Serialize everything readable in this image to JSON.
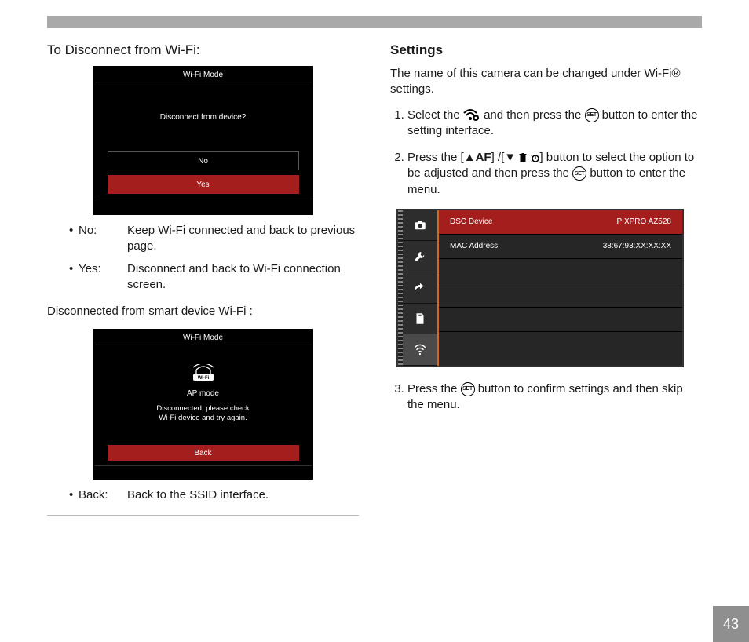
{
  "page_number": "43",
  "left": {
    "title": "To Disconnect from Wi-Fi:",
    "screen1": {
      "header": "Wi-Fi Mode",
      "prompt": "Disconnect from device?",
      "option_no": "No",
      "option_yes": "Yes"
    },
    "bullets1": [
      {
        "label": "No:",
        "text": "Keep Wi-Fi connected and back to previous page."
      },
      {
        "label": "Yes:",
        "text": "Disconnect and back to Wi-Fi connection screen."
      }
    ],
    "subtitle": "Disconnected from smart device Wi-Fi :",
    "screen2": {
      "header": "Wi-Fi Mode",
      "ap_mode": "AP mode",
      "message_line1": "Disconnected, please check",
      "message_line2": "Wi-Fi device and try again.",
      "back": "Back"
    },
    "bullets2": [
      {
        "label": "Back:",
        "text": "Back to the SSID interface."
      }
    ]
  },
  "right": {
    "title": "Settings",
    "intro": "The name of this camera can be changed under Wi-Fi® settings.",
    "step1_a": "Select the ",
    "step1_b": " and then press the ",
    "step1_c": " button to enter the setting interface.",
    "step2_a": "Press the [",
    "step2_af": "AF",
    "step2_b": "] /[",
    "step2_c": "] button to select the option to be adjusted and then press the ",
    "step2_d": " button to enter the menu.",
    "screen3": {
      "row1_label": "DSC Device",
      "row1_value": "PIXPRO AZ528",
      "row2_label": "MAC Address",
      "row2_value": "38:67:93:XX:XX:XX"
    },
    "step3_a": "Press the ",
    "step3_b": " button to confirm settings and then skip the menu.",
    "set_label": "SET"
  }
}
